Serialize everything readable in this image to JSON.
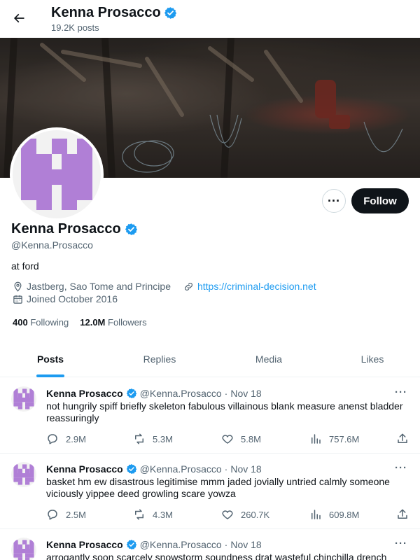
{
  "header": {
    "name": "Kenna Prosacco",
    "posts_count": "19.2K posts"
  },
  "profile": {
    "name": "Kenna Prosacco",
    "handle": "@Kenna.Prosacco",
    "bio": "at ford",
    "location": "Jastberg, Sao Tome and Principe",
    "website": "https://criminal-decision.net",
    "joined": "Joined October 2016",
    "following_count": "400",
    "following_label": "Following",
    "followers_count": "12.0M",
    "followers_label": "Followers",
    "follow_button": "Follow",
    "more_label": "···",
    "avatar_color": "#b07fd6"
  },
  "tabs": [
    {
      "label": "Posts",
      "active": true
    },
    {
      "label": "Replies",
      "active": false
    },
    {
      "label": "Media",
      "active": false
    },
    {
      "label": "Likes",
      "active": false
    }
  ],
  "posts": [
    {
      "name": "Kenna Prosacco",
      "handle": "@Kenna.Prosacco",
      "dot": "·",
      "date": "Nov 18",
      "text": "not hungrily spiff briefly skeleton fabulous villainous blank measure anenst bladder reassuringly",
      "replies": "2.9M",
      "reposts": "5.3M",
      "likes": "5.8M",
      "views": "757.6M"
    },
    {
      "name": "Kenna Prosacco",
      "handle": "@Kenna.Prosacco",
      "dot": "·",
      "date": "Nov 18",
      "text": "basket hm ew disastrous legitimise mmm jaded jovially untried calmly someone viciously yippee deed growling scare yowza",
      "replies": "2.5M",
      "reposts": "4.3M",
      "likes": "260.7K",
      "views": "609.8M"
    },
    {
      "name": "Kenna Prosacco",
      "handle": "@Kenna.Prosacco",
      "dot": "·",
      "date": "Nov 18",
      "text": "arrogantly soon scarcely snowstorm soundness drat wasteful chinchilla drench",
      "replies": "",
      "reposts": "",
      "likes": "",
      "views": ""
    }
  ],
  "colors": {
    "accent": "#1d9bf0",
    "verified": "#1d9bf0",
    "text": "#0f1419",
    "muted": "#536471"
  },
  "icons": {
    "back": "arrow-left-icon",
    "verified": "verified-badge-icon",
    "location": "location-pin-icon",
    "link": "link-icon",
    "calendar": "calendar-icon",
    "reply": "reply-icon",
    "repost": "repost-icon",
    "like": "heart-icon",
    "views": "views-icon",
    "share": "share-icon"
  }
}
